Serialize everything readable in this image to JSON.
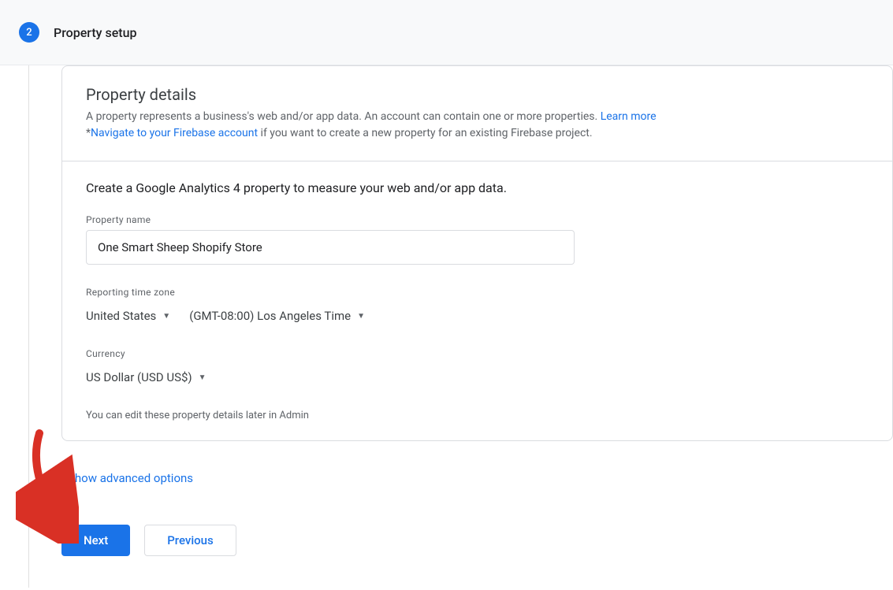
{
  "step": {
    "number": "2",
    "title": "Property setup"
  },
  "details": {
    "heading": "Property details",
    "description": "A property represents a business's web and/or app data. An account can contain one or more properties. ",
    "learn_more": "Learn more",
    "firebase_prefix": "*",
    "firebase_link": "Navigate to your Firebase account",
    "firebase_suffix": " if you want to create a new property for an existing Firebase project."
  },
  "form": {
    "sub_heading": "Create a Google Analytics 4 property to measure your web and/or app data.",
    "property_name_label": "Property name",
    "property_name_value": "One Smart Sheep Shopify Store",
    "timezone_label": "Reporting time zone",
    "timezone_country": "United States",
    "timezone_value": "(GMT-08:00) Los Angeles Time",
    "currency_label": "Currency",
    "currency_value": "US Dollar (USD US$)",
    "hint": "You can edit these property details later in Admin"
  },
  "advanced_link": "Show advanced options",
  "buttons": {
    "next": "Next",
    "previous": "Previous"
  }
}
